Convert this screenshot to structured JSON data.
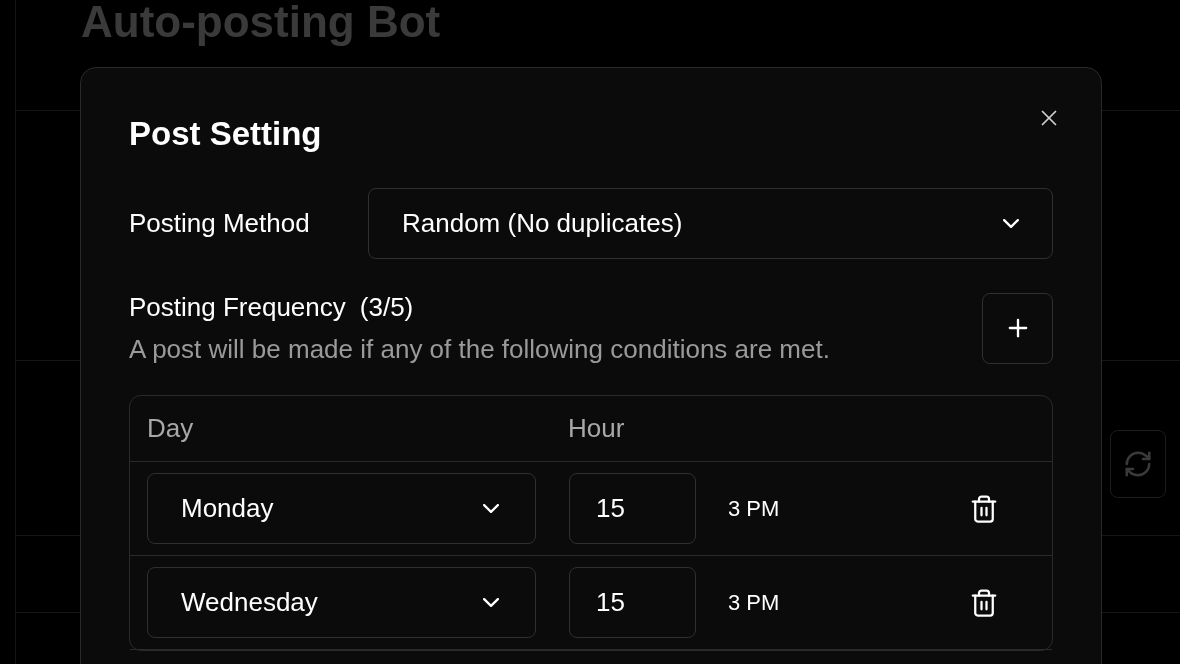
{
  "page": {
    "title": "Auto-posting Bot"
  },
  "dialog": {
    "title": "Post Setting",
    "posting_method": {
      "label": "Posting Method",
      "value": "Random (No duplicates)"
    },
    "posting_frequency": {
      "label": "Posting Frequency",
      "count": "(3/5)",
      "description": "A post will be made if any of the following conditions are met."
    },
    "table": {
      "columns": [
        "Day",
        "Hour"
      ],
      "rows": [
        {
          "day": "Monday",
          "hour": "15",
          "time": "3 PM"
        },
        {
          "day": "Wednesday",
          "hour": "15",
          "time": "3 PM"
        }
      ]
    }
  }
}
